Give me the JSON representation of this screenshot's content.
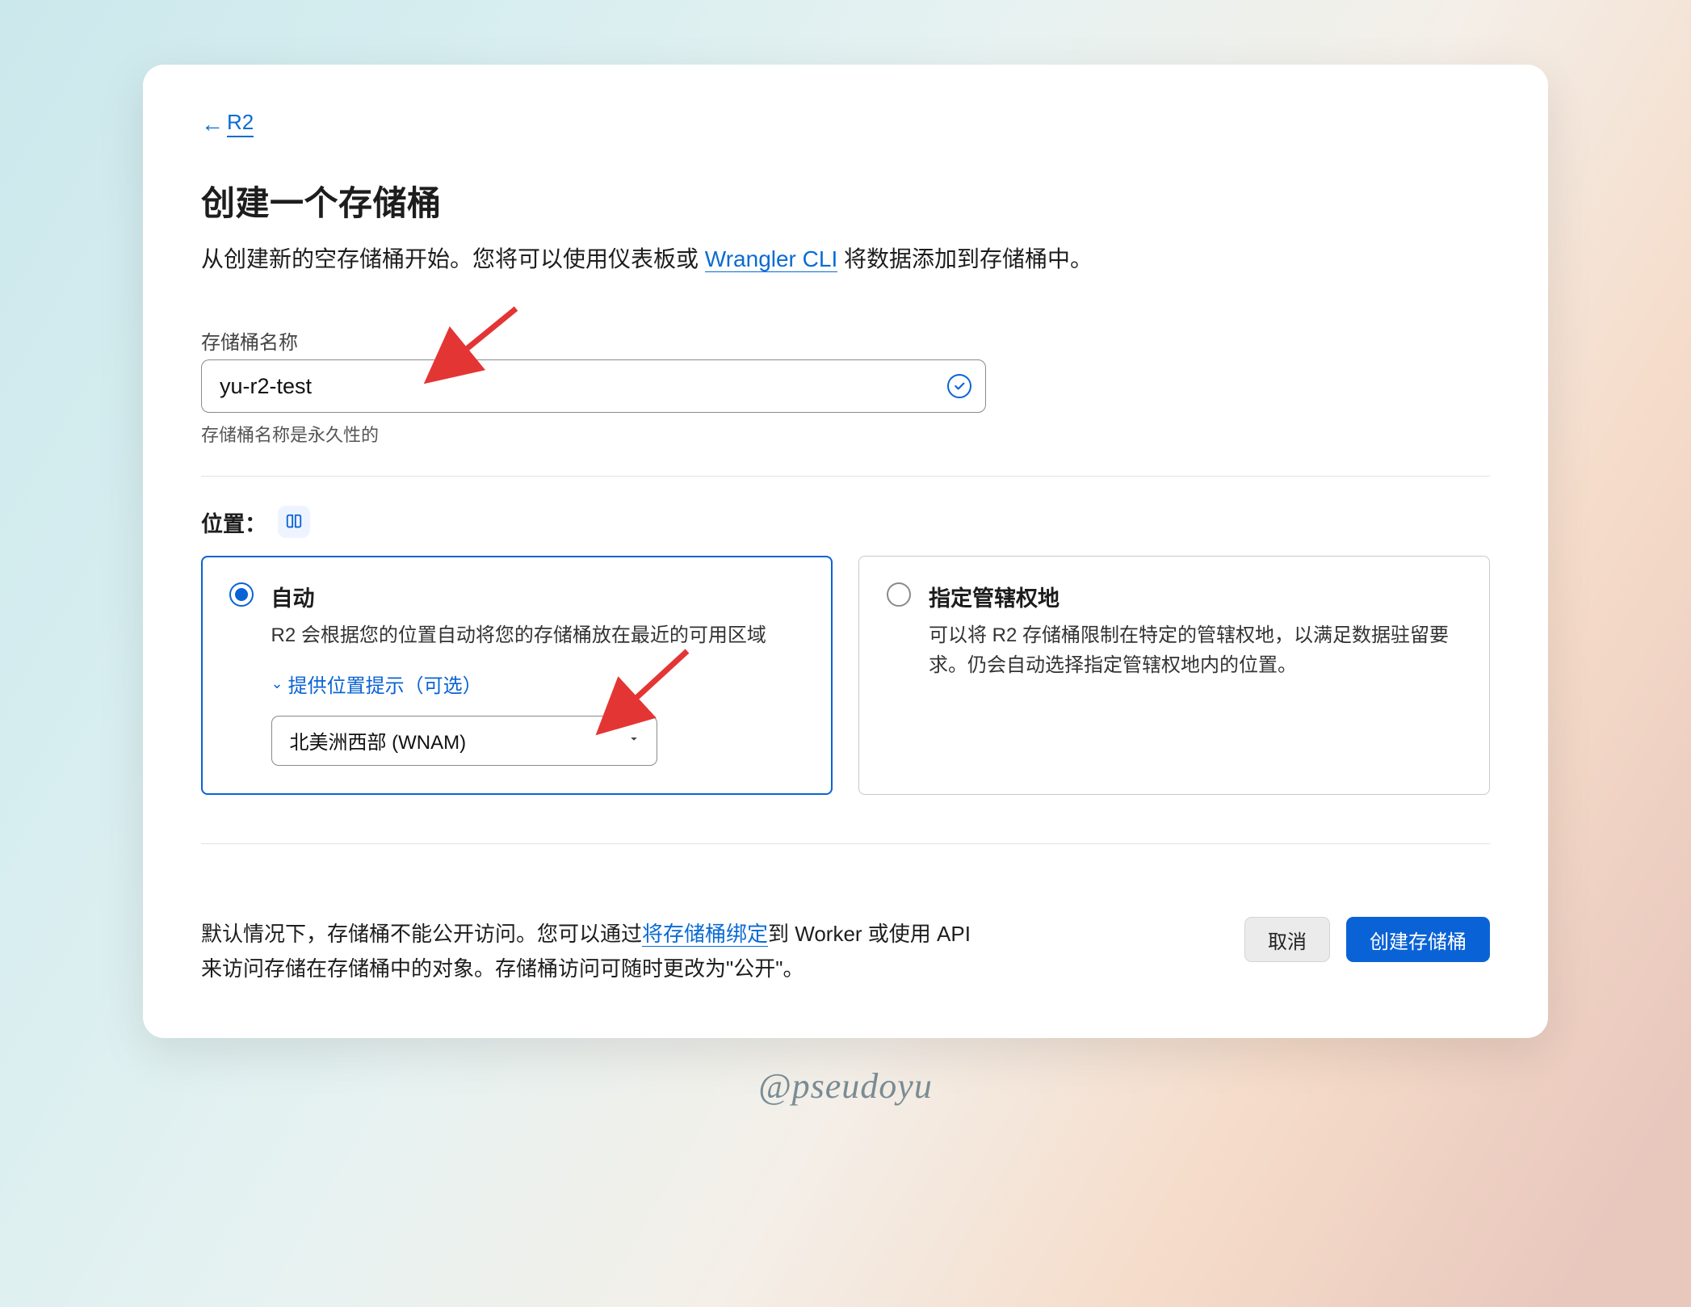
{
  "back": {
    "label": "R2"
  },
  "title": "创建一个存储桶",
  "description": {
    "before": "从创建新的空存储桶开始。您将可以使用仪表板或 ",
    "link": "Wrangler CLI",
    "after": " 将数据添加到存储桶中。"
  },
  "bucketName": {
    "label": "存储桶名称",
    "value": "yu-r2-test",
    "helper": "存储桶名称是永久性的"
  },
  "location": {
    "label": "位置：",
    "options": {
      "auto": {
        "title": "自动",
        "desc": "R2 会根据您的位置自动将您的存储桶放在最近的可用区域",
        "hintToggle": "提供位置提示（可选）",
        "hintSelected": "北美洲西部 (WNAM)"
      },
      "jurisdiction": {
        "title": "指定管辖权地",
        "desc": "可以将 R2 存储桶限制在特定的管辖权地，以满足数据驻留要求。仍会自动选择指定管辖权地内的位置。"
      }
    },
    "selected": "auto"
  },
  "footer": {
    "textBefore": "默认情况下，存储桶不能公开访问。您可以通过",
    "link": "将存储桶绑定",
    "textMid": "到 Worker 或使用 API",
    "line2": "来访问存储在存储桶中的对象。存储桶访问可随时更改为\"公开\"。",
    "cancel": "取消",
    "create": "创建存储桶"
  },
  "watermark": "@pseudoyu"
}
